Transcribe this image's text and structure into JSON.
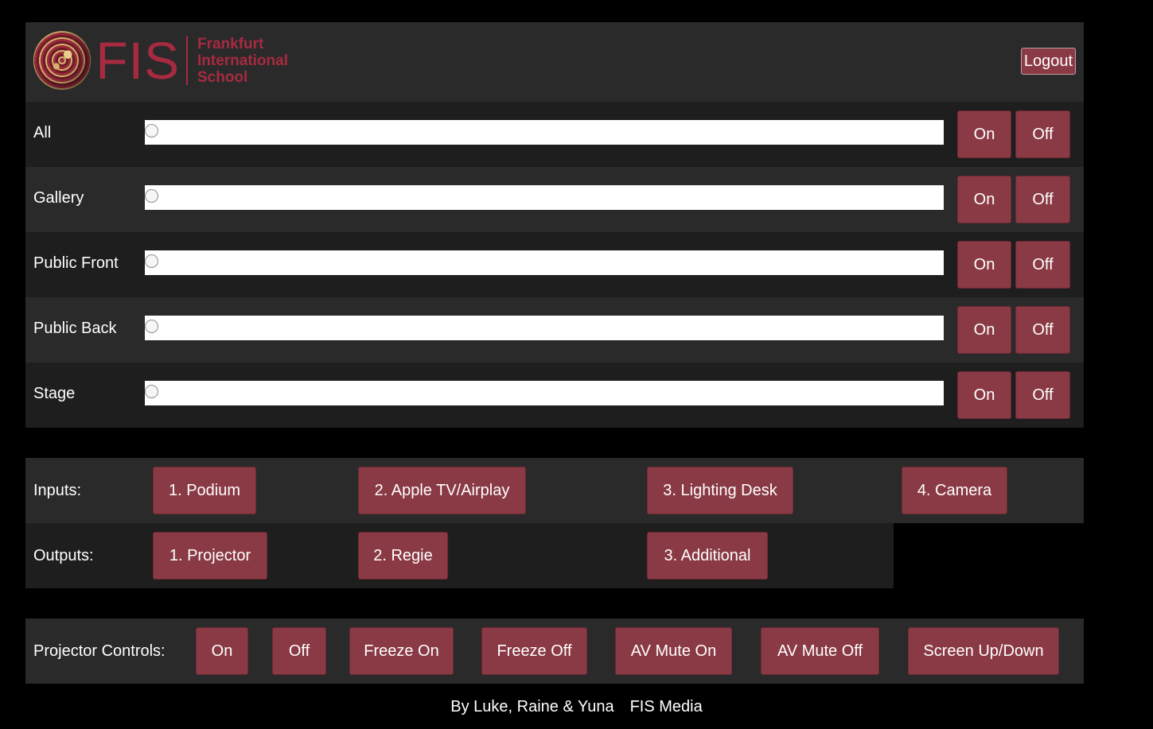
{
  "header": {
    "logo_mark": "FIS",
    "school_lines": [
      "Frankfurt",
      "International",
      "School"
    ],
    "logout_label": "Logout"
  },
  "zones": [
    {
      "label": "All",
      "level": 0,
      "on_label": "On",
      "off_label": "Off"
    },
    {
      "label": "Gallery",
      "level": 0,
      "on_label": "On",
      "off_label": "Off"
    },
    {
      "label": "Public Front",
      "level": 0,
      "on_label": "On",
      "off_label": "Off"
    },
    {
      "label": "Public Back",
      "level": 0,
      "on_label": "On",
      "off_label": "Off"
    },
    {
      "label": "Stage",
      "level": 0,
      "on_label": "On",
      "off_label": "Off"
    }
  ],
  "inputs": {
    "label": "Inputs:",
    "items": [
      "1. Podium",
      "2. Apple TV/Airplay",
      "3. Lighting Desk",
      "4. Camera"
    ]
  },
  "outputs": {
    "label": "Outputs:",
    "items": [
      "1. Projector",
      "2. Regie",
      "3. Additional"
    ]
  },
  "projector": {
    "label": "Projector Controls:",
    "buttons": [
      "On",
      "Off",
      "Freeze On",
      "Freeze Off",
      "AV Mute On",
      "AV Mute Off",
      "Screen Up/Down"
    ]
  },
  "footer": {
    "credits": "By Luke, Raine & Yuna",
    "org": "FIS Media"
  },
  "colors": {
    "button": "#8a3a44",
    "brand": "#a72a40",
    "panel_dark": "#1e1e1e",
    "panel_light": "#2a2a2a"
  }
}
